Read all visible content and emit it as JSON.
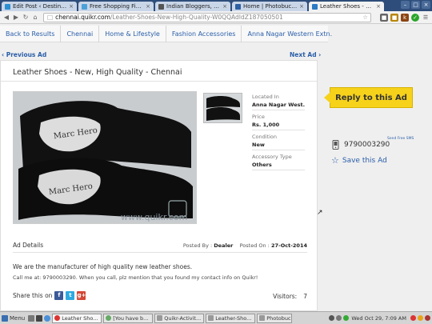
{
  "browser": {
    "tabs": [
      {
        "label": "Edit Post ‹ Destinatio",
        "color": "#2b8fd1",
        "active": false
      },
      {
        "label": "Free Shopping Fiesta",
        "color": "#4aa1d9",
        "active": false
      },
      {
        "label": "Indian Bloggers, Sho",
        "color": "#555555",
        "active": false
      },
      {
        "label": "Home | Photobucket",
        "color": "#2c5fa3",
        "active": false
      },
      {
        "label": "Leather Shoes - New",
        "color": "#2c7bc4",
        "active": true
      }
    ],
    "close_glyph": "×",
    "window_buttons": [
      "–",
      "□",
      "×"
    ],
    "url_host": "chennai.quikr.com",
    "url_path": "/Leather-Shoes-New-High-Quality-W0QQAdIdZ187050501"
  },
  "breadcrumb": [
    "Back to Results",
    "Chennai",
    "Home & Lifestyle",
    "Fashion Accessories",
    "Anna Nagar Western Extn."
  ],
  "nav": {
    "prev": "‹ Previous Ad",
    "next": "Next Ad ›"
  },
  "ad": {
    "title": "Leather Shoes - New, High Quality - Chennai",
    "watermark": "www.quikr.com",
    "attributes": [
      {
        "label": "Located In",
        "value": "Anna Nagar West..."
      },
      {
        "label": "Price",
        "value": "Rs. 1,000"
      },
      {
        "label": "Condition",
        "value": "New"
      },
      {
        "label": "Accessory Type",
        "value": "Others"
      }
    ],
    "details_label": "Ad Details",
    "posted_by_label": "Posted By :",
    "posted_by": "Dealer",
    "posted_on_label": "Posted On :",
    "posted_on": "27-Oct-2014",
    "description": "We are the manufacturer of high quality new leather shoes.",
    "contact_line": "Call me at: 9790003290. When you call, plz mention that you found my contact info on Quikr!",
    "share_label": "Share this on",
    "visitors_label": "Visitors:",
    "visitors": "7"
  },
  "sidebar": {
    "reply_label": "Reply to this Ad",
    "phone": "9790003290",
    "send_free": "Send Free SMS",
    "save_label": "Save this Ad"
  },
  "taskbar": {
    "menu_label": "Menu",
    "tasks": [
      "Leather Sho...",
      "[You have b...",
      "Quikr-Activit...",
      "Leather-Sho...",
      "Photobucket..."
    ],
    "clock": "Wed Oct 29, 7:09 AM"
  },
  "colors": {
    "link": "#2a5ea8",
    "reply_bg": "#f6d21b",
    "tab_bar": "#2e4d7a"
  }
}
